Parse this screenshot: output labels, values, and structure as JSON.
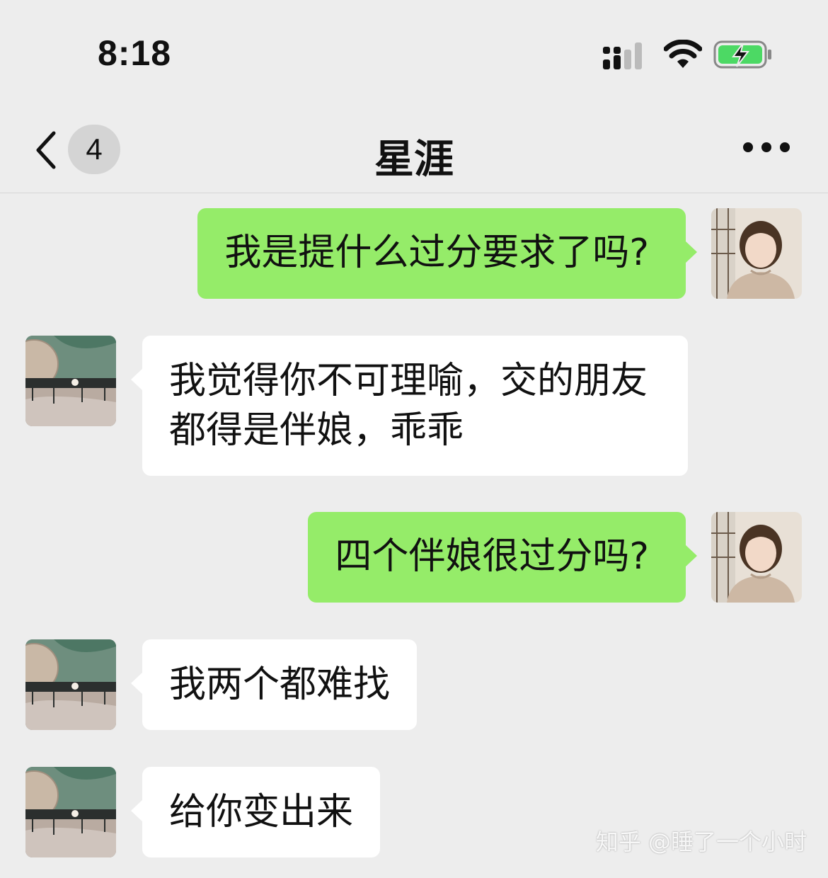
{
  "status_bar": {
    "time": "8:18",
    "icons": [
      "signal-icon",
      "wifi-icon",
      "battery-charging-icon"
    ],
    "battery_color": "#4cd964"
  },
  "nav": {
    "back_icon": "chevron-left-icon",
    "unread_count": "4",
    "title": "星涯",
    "more_icon": "ellipsis-icon"
  },
  "messages": [
    {
      "sender": "self",
      "text": "我是提什么过分要求了吗?"
    },
    {
      "sender": "other",
      "text": "我觉得你不可理喻，交的朋友都得是伴娘，乖乖"
    },
    {
      "sender": "self",
      "text": "四个伴娘很过分吗?"
    },
    {
      "sender": "other",
      "text": "我两个都难找"
    },
    {
      "sender": "other",
      "text": "给你变出来"
    }
  ],
  "colors": {
    "self_bubble": "#95ec69",
    "other_bubble": "#ffffff",
    "background": "#ededed"
  },
  "watermark": "知乎 @睡了一个小时"
}
